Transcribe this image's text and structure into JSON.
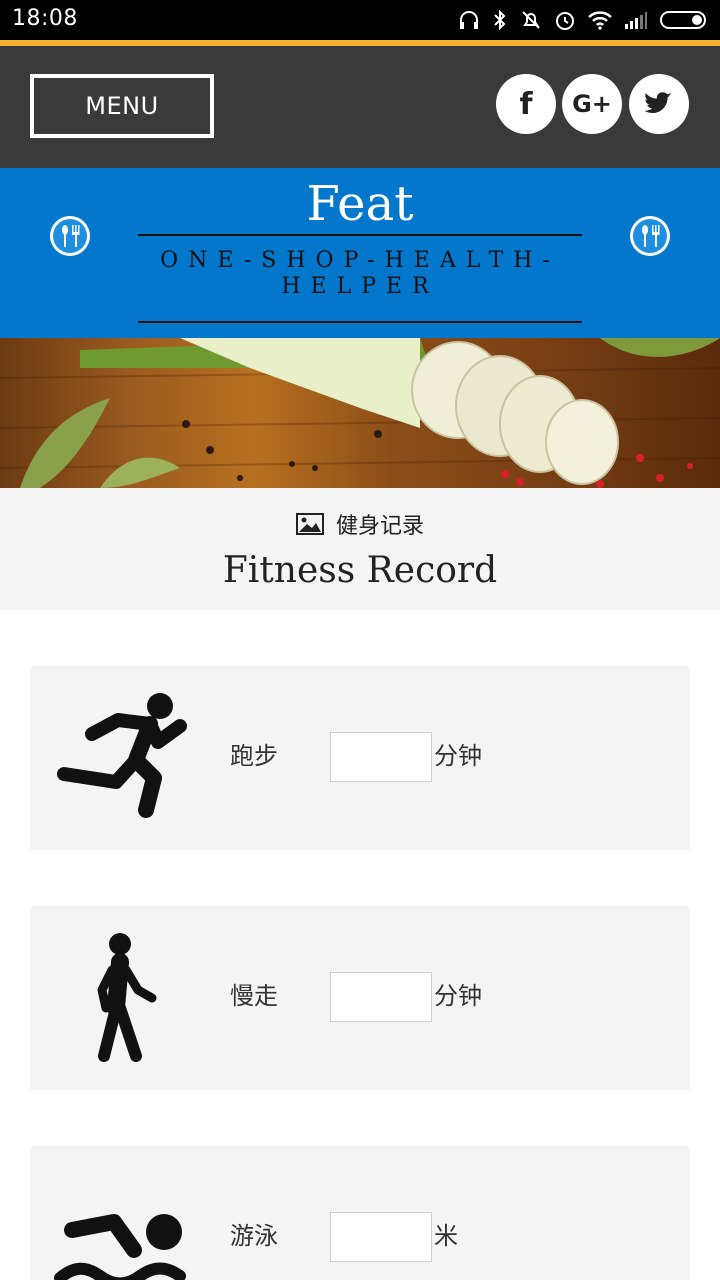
{
  "status_bar": {
    "time": "18:08"
  },
  "header": {
    "menu_label": "MENU",
    "social": [
      "f",
      "G+",
      "twitter"
    ]
  },
  "brand": {
    "title": "Feat",
    "tagline": "ONE-SHOP-HEALTH-HELPER"
  },
  "section": {
    "subtitle": "健身记录",
    "title": "Fitness Record"
  },
  "activities": [
    {
      "label": "跑步",
      "unit": "分钟",
      "value": "",
      "icon": "running-person-icon"
    },
    {
      "label": "慢走",
      "unit": "分钟",
      "value": "",
      "icon": "walking-person-icon"
    },
    {
      "label": "游泳",
      "unit": "米",
      "value": "",
      "icon": "swimming-person-icon"
    }
  ],
  "colors": {
    "header_bg": "#3a3a3a",
    "brand_bg": "#0277cc",
    "accent_line": "#f2b230",
    "card_bg": "#f4f4f4"
  }
}
